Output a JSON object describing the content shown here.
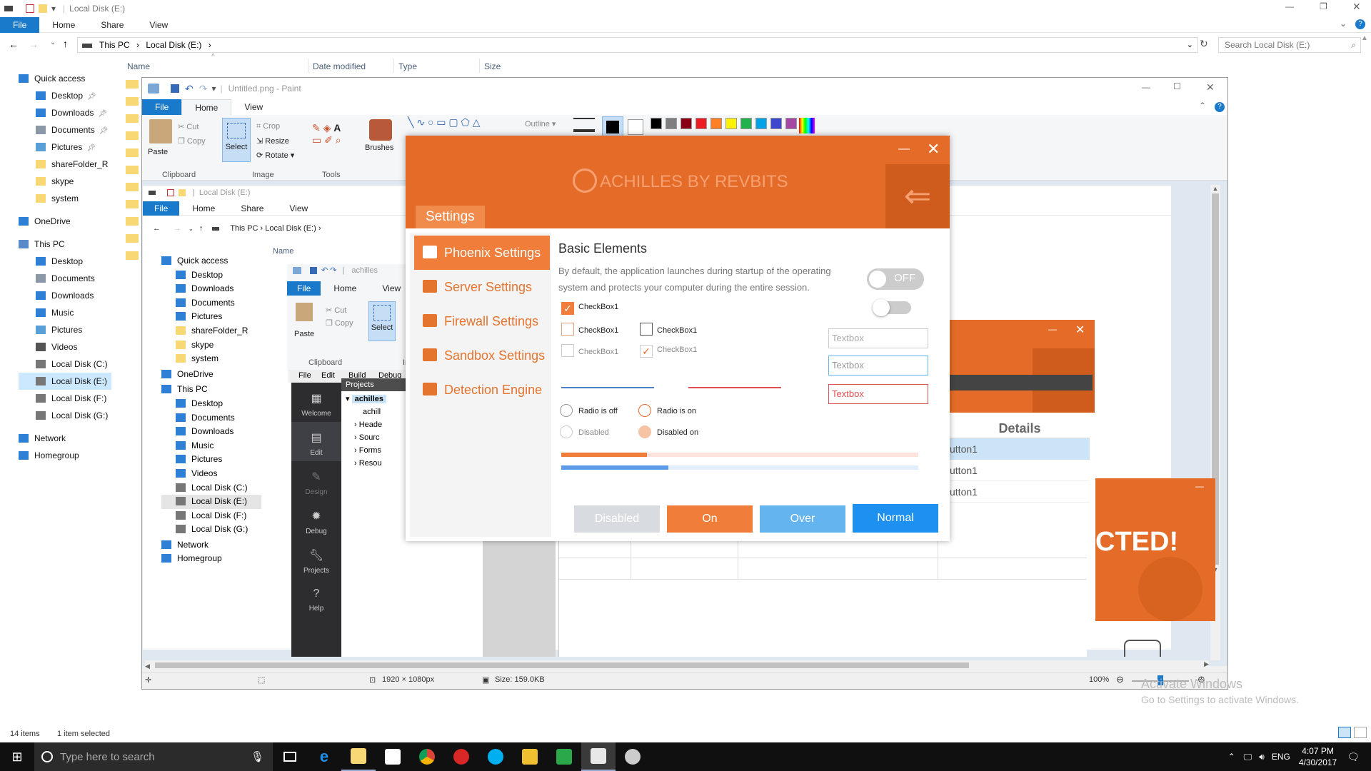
{
  "explorer": {
    "title": "Local Disk (E:)",
    "tabs": [
      "File",
      "Home",
      "Share",
      "View"
    ],
    "breadcrumb": [
      "This PC",
      "Local Disk (E:)"
    ],
    "search_placeholder": "Search Local Disk (E:)",
    "columns": [
      "Name",
      "Date modified",
      "Type",
      "Size"
    ],
    "nav": [
      {
        "label": "Quick access",
        "icon": "star-icon"
      },
      {
        "label": "Desktop",
        "icon": "desktop-icon",
        "pinned": true
      },
      {
        "label": "Downloads",
        "icon": "downloads-icon",
        "pinned": true
      },
      {
        "label": "Documents",
        "icon": "documents-icon",
        "pinned": true
      },
      {
        "label": "Pictures",
        "icon": "pictures-icon",
        "pinned": true
      },
      {
        "label": "shareFolder_R",
        "icon": "folder-icon"
      },
      {
        "label": "skype",
        "icon": "folder-icon"
      },
      {
        "label": "system",
        "icon": "folder-icon"
      },
      {
        "label": "OneDrive",
        "icon": "onedrive-icon"
      },
      {
        "label": "This PC",
        "icon": "pc-icon"
      },
      {
        "label": "Desktop",
        "icon": "desktop-icon"
      },
      {
        "label": "Documents",
        "icon": "documents-icon"
      },
      {
        "label": "Downloads",
        "icon": "downloads-icon"
      },
      {
        "label": "Music",
        "icon": "music-icon"
      },
      {
        "label": "Pictures",
        "icon": "pictures-icon"
      },
      {
        "label": "Videos",
        "icon": "videos-icon"
      },
      {
        "label": "Local Disk (C:)",
        "icon": "drive-icon"
      },
      {
        "label": "Local Disk (E:)",
        "icon": "drive-icon",
        "selected": true
      },
      {
        "label": "Local Disk (F:)",
        "icon": "drive-icon"
      },
      {
        "label": "Local Disk (G:)",
        "icon": "drive-icon"
      },
      {
        "label": "Network",
        "icon": "network-icon"
      },
      {
        "label": "Homegroup",
        "icon": "homegroup-icon"
      }
    ],
    "status_items": "14 items",
    "status_selected": "1 item selected"
  },
  "paint": {
    "title": "Untitled.png - Paint",
    "tabs": [
      "File",
      "Home",
      "View"
    ],
    "clipboard": {
      "paste": "Paste",
      "cut": "Cut",
      "copy": "Copy",
      "group": "Clipboard"
    },
    "image": {
      "select": "Select",
      "crop": "Crop",
      "resize": "Resize",
      "rotate": "Rotate",
      "group": "Image"
    },
    "tools_group": "Tools",
    "brushes": "Brushes",
    "outline": "Outline",
    "status_size": "1920 × 1080px",
    "status_file": "Size: 159.0KB",
    "zoom": "100%",
    "palette": [
      "#000000",
      "#7f7f7f",
      "#880015",
      "#ed1c24",
      "#ff7f27",
      "#fff200",
      "#22b14c",
      "#00a2e8",
      "#3f48cc",
      "#a349a4"
    ]
  },
  "explorer2": {
    "title": "Local Disk (E:)",
    "tabs": [
      "File",
      "Home",
      "Share",
      "View"
    ],
    "breadcrumb": [
      "This PC",
      "Local Disk (E:)"
    ],
    "column": "Name",
    "nav": [
      "Quick access",
      "Desktop",
      "Downloads",
      "Documents",
      "Pictures",
      "shareFolder_R",
      "skype",
      "system",
      "OneDrive",
      "This PC",
      "Desktop",
      "Documents",
      "Downloads",
      "Music",
      "Pictures",
      "Videos",
      "Local Disk (C:)",
      "Local Disk (E:)",
      "Local Disk (F:)",
      "Local Disk (G:)",
      "Network",
      "Homegroup"
    ]
  },
  "paint2": {
    "title": "achilles",
    "tabs": [
      "File",
      "Home",
      "View"
    ],
    "paste": "Paste",
    "cut": "Cut",
    "copy": "Copy",
    "select": "Select",
    "group": "Clipboard",
    "group2": "Ima"
  },
  "vs": {
    "menu": [
      "File",
      "Edit",
      "Build",
      "Debug"
    ],
    "panel": "Projects",
    "side": [
      "Welcome",
      "Edit",
      "Design",
      "Debug",
      "Projects",
      "Help"
    ],
    "tree": [
      "achilles",
      "achill",
      "Heade",
      "Sourc",
      "Forms",
      "Resou"
    ]
  },
  "achilles": {
    "logo": "ACHILLES BY REVBITS",
    "settings_tab": "Settings",
    "menu": [
      {
        "label": "Phoenix Settings",
        "icon": "phoenix-icon",
        "selected": true
      },
      {
        "label": "Server Settings",
        "icon": "server-icon"
      },
      {
        "label": "Firewall Settings",
        "icon": "firewall-icon"
      },
      {
        "label": "Sandbox Settings",
        "icon": "sandbox-icon"
      },
      {
        "label": "Detection Engine",
        "icon": "bug-icon"
      }
    ],
    "section_title": "Basic Elements",
    "description": "By default, the application launches during startup of the operating system and protects your computer during the entire session.",
    "toggle_label": "OFF",
    "checkbox_label": "CheckBox1",
    "radio_off": "Radio is off",
    "radio_on": "Radio is on",
    "radio_disabled": "Disabled",
    "radio_disabled_on": "Disabled on",
    "textbox_placeholder": "Textbox",
    "progress": [
      0.24,
      0.3
    ],
    "buttons": [
      "Disabled",
      "On",
      "Over",
      "Normal"
    ],
    "colors": {
      "accent": "#e56c28",
      "light": "#f08b4b",
      "over": "#64b4f0",
      "normal": "#1e90f0",
      "disabled": "#d8dce0"
    }
  },
  "achilles2": {
    "details": "Details",
    "rows": [
      "utton1",
      "utton1",
      "utton1"
    ],
    "banner": "CTED!"
  },
  "watermark": {
    "line1": "Activate Windows",
    "line2": "Go to Settings to activate Windows."
  },
  "taskbar": {
    "search": "Type here to search",
    "time": "4:07 PM",
    "date": "4/30/2017",
    "lang": "ENG"
  }
}
